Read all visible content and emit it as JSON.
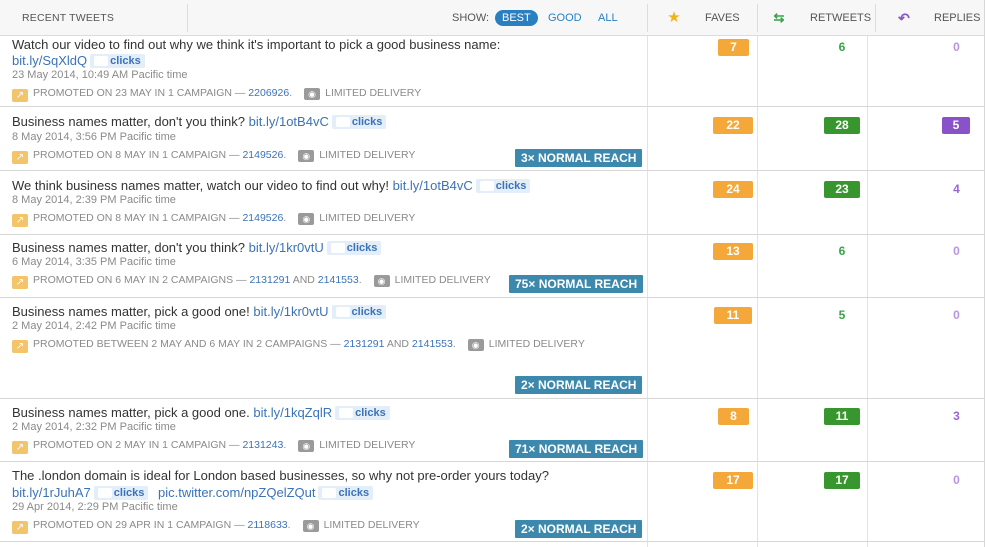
{
  "header": {
    "recent": "RECENT TWEETS",
    "show": "SHOW:",
    "filters": [
      "BEST",
      "GOOD",
      "ALL"
    ],
    "faves": "FAVES",
    "retweets": "RETWEETS",
    "replies": "REPLIES",
    "icons": [
      "star-icon",
      "retweet-icon",
      "reply-icon"
    ]
  },
  "tweets": [
    {
      "text": "Watch our video to find out why we think it's important to pick a good business name:",
      "link1": "bit.ly/SqXldQ",
      "clicks1": "clicks",
      "date": "23 May 2014, 10:49 AM Pacific time",
      "promo": "PROMOTED ON 23 MAY IN 1 CAMPAIGN —",
      "campaign1": "2206926",
      "campaign_and": "",
      "campaign2": "",
      "delivery": "LIMITED DELIVERY",
      "reach": "",
      "faves": "7",
      "retweets": "6",
      "replies": "0"
    },
    {
      "text": "Business names matter, don't you think?",
      "link1": "bit.ly/1otB4vC",
      "clicks1": "clicks",
      "date": "8 May 2014, 3:56 PM Pacific time",
      "promo": "PROMOTED ON 8 MAY IN 1 CAMPAIGN —",
      "campaign1": "2149526",
      "campaign_and": "",
      "campaign2": "",
      "delivery": "LIMITED DELIVERY",
      "reach": "3× NORMAL REACH",
      "faves": "22",
      "retweets": "28",
      "replies": "5"
    },
    {
      "text": "We think business names matter, watch our video to find out why!",
      "link1": "bit.ly/1otB4vC",
      "clicks1": "clicks",
      "date": "8 May 2014, 2:39 PM Pacific time",
      "promo": "PROMOTED ON 8 MAY IN 1 CAMPAIGN —",
      "campaign1": "2149526",
      "campaign_and": "",
      "campaign2": "",
      "delivery": "LIMITED DELIVERY",
      "reach": "",
      "faves": "24",
      "retweets": "23",
      "replies": "4"
    },
    {
      "text": "Business names matter, don't you think?",
      "link1": "bit.ly/1kr0vtU",
      "clicks1": "clicks",
      "date": "6 May 2014, 3:35 PM Pacific time",
      "promo": "PROMOTED ON 6 MAY IN 2 CAMPAIGNS —",
      "campaign1": "2131291",
      "campaign_and": "AND",
      "campaign2": "2141553",
      "delivery": "LIMITED DELIVERY",
      "reach": "75× NORMAL REACH",
      "faves": "13",
      "retweets": "6",
      "replies": "0"
    },
    {
      "text": "Business names matter, pick a good one!",
      "link1": "bit.ly/1kr0vtU",
      "clicks1": "clicks",
      "date": "2 May 2014, 2:42 PM Pacific time",
      "promo": "PROMOTED BETWEEN 2 MAY AND 6 MAY IN 2 CAMPAIGNS —",
      "campaign1": "2131291",
      "campaign_and": "AND",
      "campaign2": "2141553",
      "delivery": "LIMITED DELIVERY",
      "reach": "2× NORMAL REACH",
      "faves": "11",
      "retweets": "5",
      "replies": "0"
    },
    {
      "text": "Business names matter, pick a good one.",
      "link1": "bit.ly/1kqZqlR",
      "clicks1": "clicks",
      "date": "2 May 2014, 2:32 PM Pacific time",
      "promo": "PROMOTED ON 2 MAY IN 1 CAMPAIGN —",
      "campaign1": "2131243",
      "campaign_and": "",
      "campaign2": "",
      "delivery": "LIMITED DELIVERY",
      "reach": "71× NORMAL REACH",
      "faves": "8",
      "retweets": "11",
      "replies": "3"
    },
    {
      "text": "The .london domain is ideal for London based businesses, so why not pre-order yours today?",
      "link1": "bit.ly/1rJuhA7",
      "clicks1": "clicks",
      "link2": "pic.twitter.com/npZQelZQut",
      "clicks2": "clicks",
      "date": "29 Apr 2014, 2:29 PM Pacific time",
      "promo": "PROMOTED ON 29 APR IN 1 CAMPAIGN —",
      "campaign1": "2118633",
      "campaign_and": "",
      "campaign2": "",
      "delivery": "LIMITED DELIVERY",
      "reach": "2× NORMAL REACH",
      "faves": "17",
      "retweets": "17",
      "replies": "0"
    }
  ],
  "colors": {
    "accent": "#2a7fc1",
    "fave": "#f4a83a",
    "retweet": "#38962e",
    "reply": "#8a52c9",
    "reach": "#3d88ad"
  }
}
